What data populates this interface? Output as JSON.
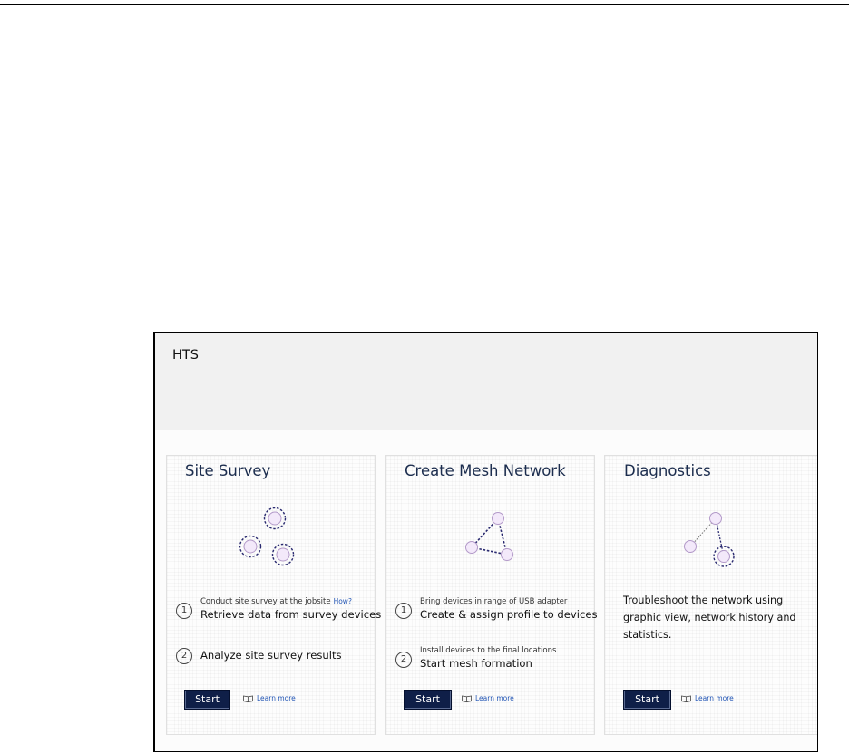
{
  "app": {
    "title": "HTS"
  },
  "cards": [
    {
      "title": "Site Survey",
      "steps": [
        {
          "num": "1",
          "sub": "Conduct site survey at the jobsite",
          "link": "How?",
          "main": "Retrieve data from survey devices"
        },
        {
          "num": "2",
          "sub": "",
          "main": "Analyze site survey results"
        }
      ],
      "start_label": "Start",
      "learn_label": "Learn more",
      "icon": "survey-circles-icon"
    },
    {
      "title": "Create Mesh Network",
      "steps": [
        {
          "num": "1",
          "sub": "Bring devices in range of USB adapter",
          "main": "Create & assign profile to devices"
        },
        {
          "num": "2",
          "sub": "Install devices to the final locations",
          "main": "Start mesh formation"
        }
      ],
      "start_label": "Start",
      "learn_label": "Learn more",
      "icon": "mesh-triangle-icon"
    },
    {
      "title": "Diagnostics",
      "description": "Troubleshoot the network using graphic view, network history and statistics.",
      "start_label": "Start",
      "learn_label": "Learn more",
      "icon": "diagnostics-nodes-icon"
    }
  ],
  "colors": {
    "title_navy": "#1c2d4e",
    "button_navy": "#0f1f48",
    "link_blue": "#2356b5",
    "node_fill": "#f3e9fa",
    "node_stroke": "#b39ac9",
    "dash_navy": "#2a2a70"
  }
}
